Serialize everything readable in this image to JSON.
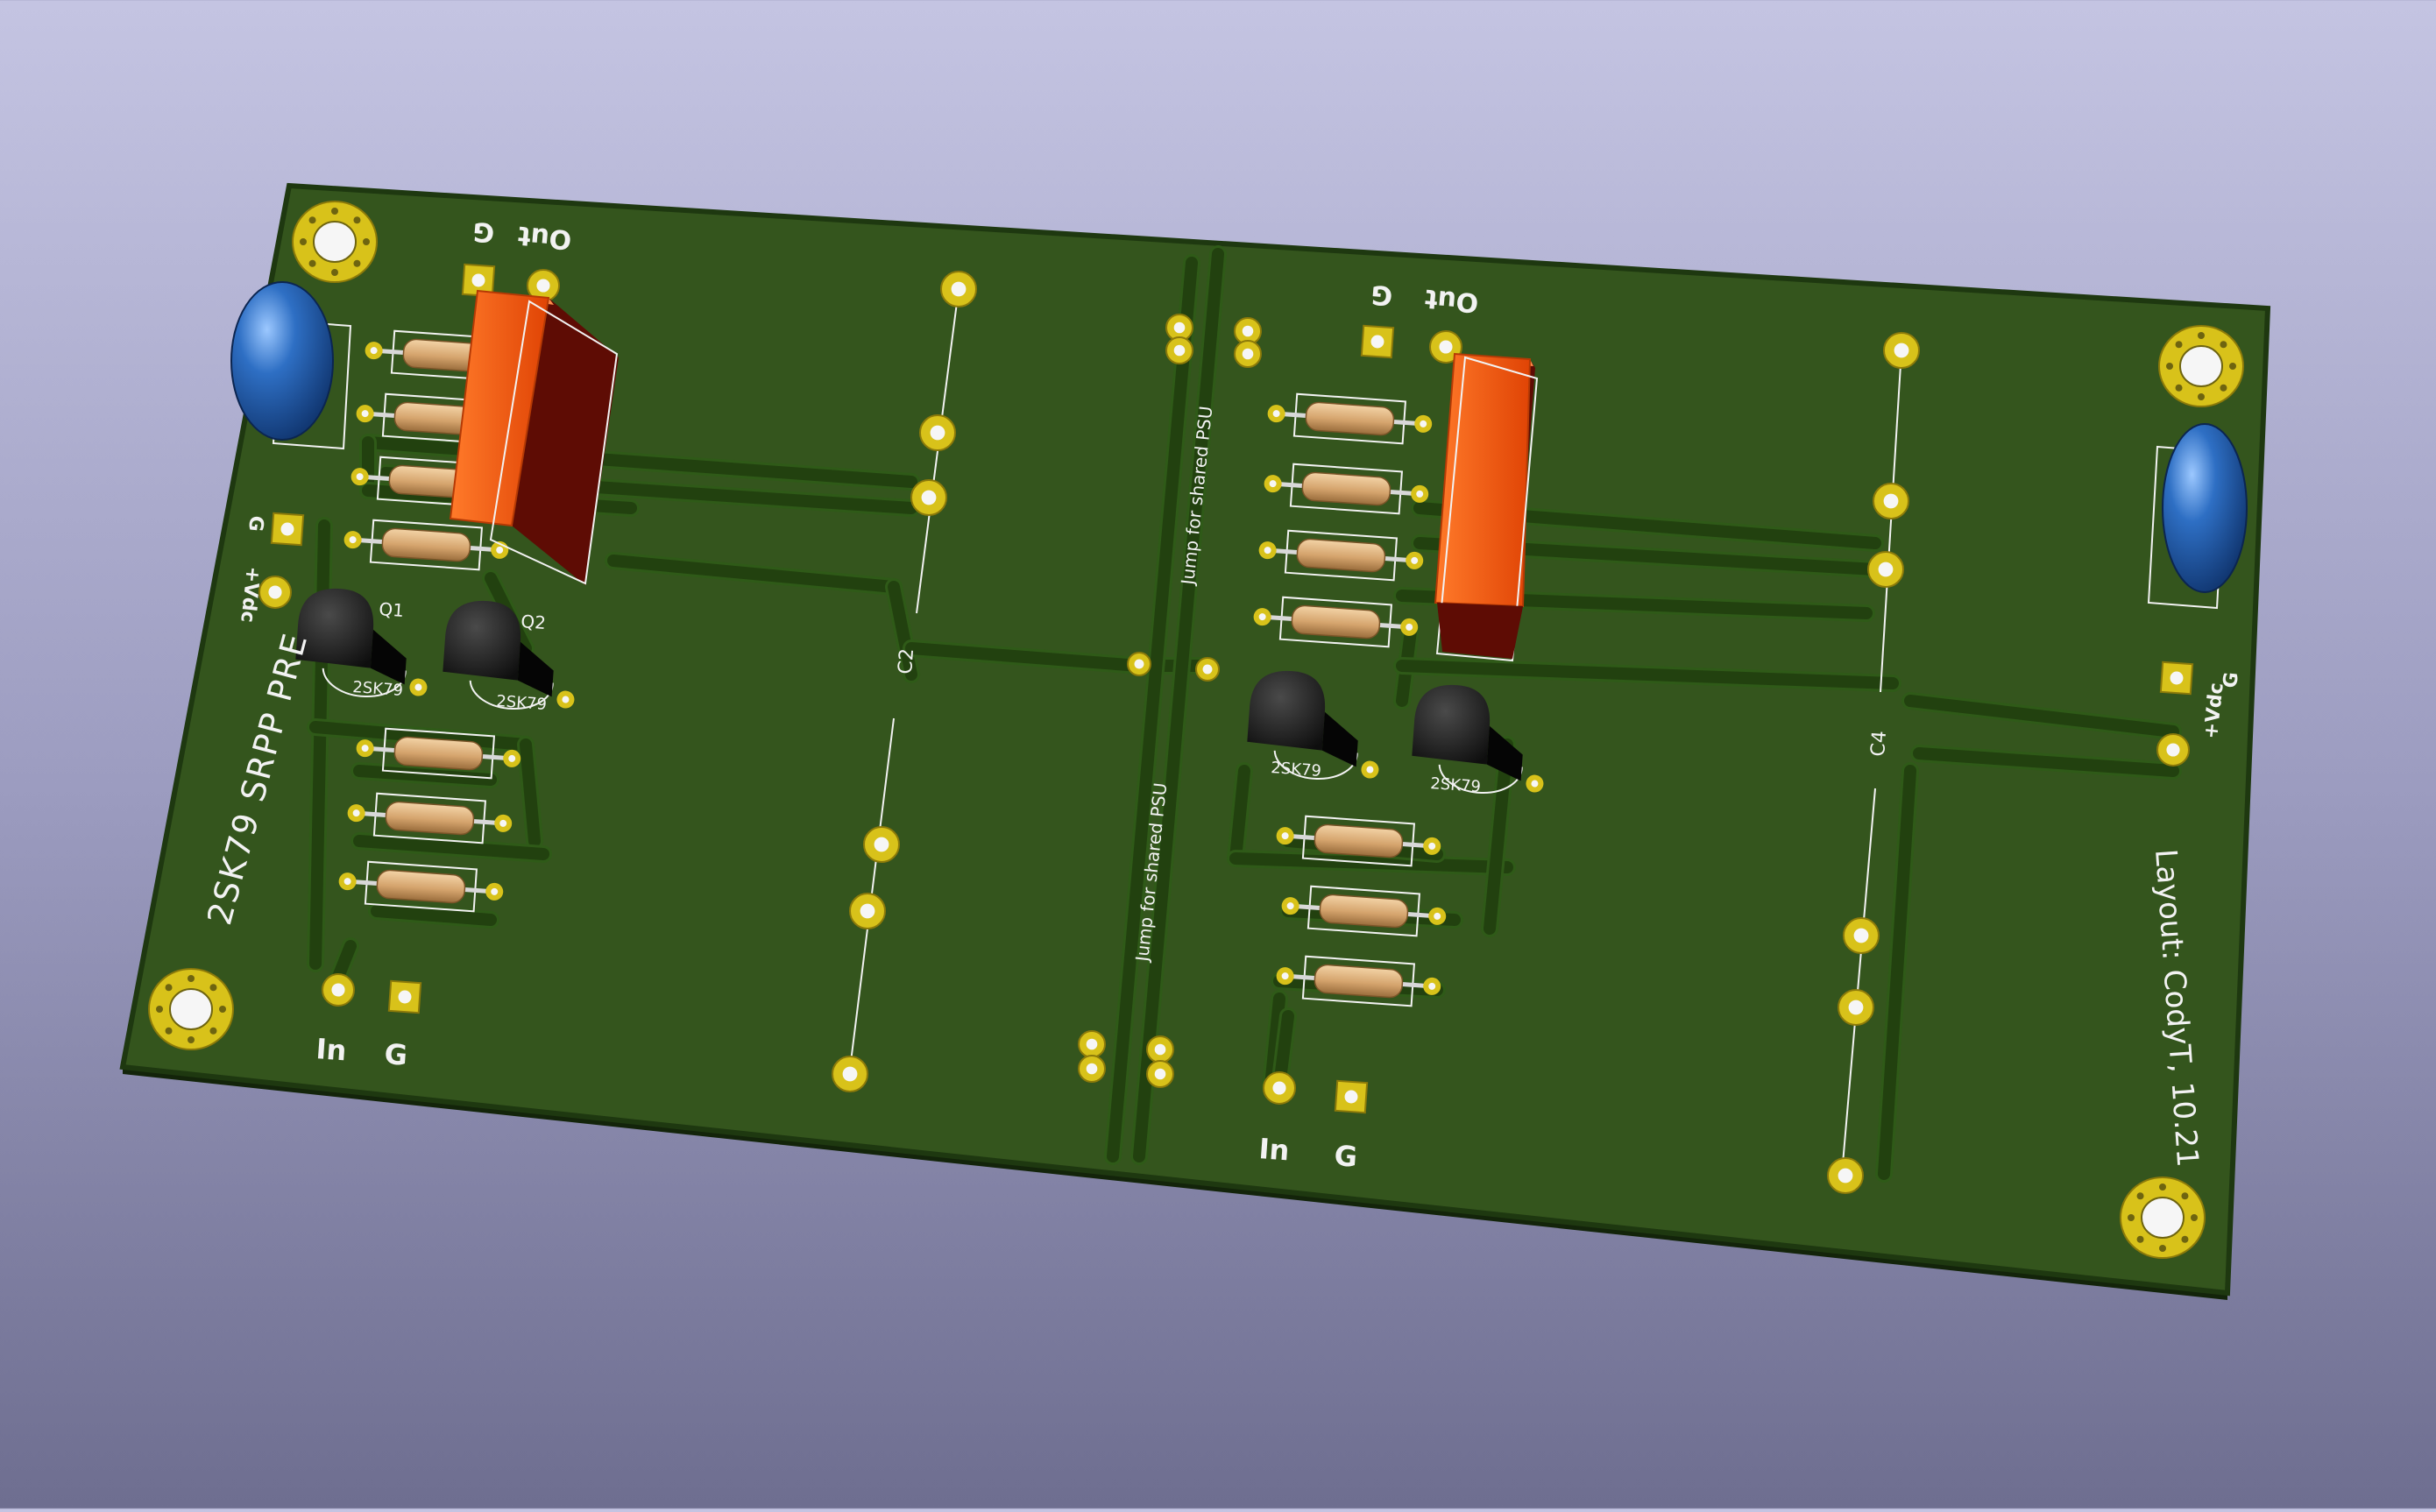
{
  "board": {
    "title": "2SK79 SRPP PRE",
    "credit": "Layout: CodyT, 10.21",
    "jumper_note": "Jump for shared PSU"
  },
  "channels": [
    {
      "out_label": "Out",
      "gnd_out_label": "G",
      "in_label": "In",
      "gnd_in_label": "G",
      "vdc_label": "+Vdc",
      "gnd_pwr_label": "G",
      "q_top_label": "Q1",
      "q_bottom_label": "Q2",
      "q_part_a": "2SK79",
      "q_part_b": "2SK79",
      "cap_label": "C2"
    },
    {
      "out_label": "Out",
      "gnd_out_label": "G",
      "in_label": "In",
      "gnd_in_label": "G",
      "vdc_label": "+Vdc",
      "gnd_pwr_label": "G",
      "q_part_a": "2SK79",
      "q_part_b": "2SK79",
      "cap_label": "C4"
    }
  ],
  "colors": {
    "background_top": "#c4c4e2",
    "background_bottom": "#6e6e90",
    "board_green": "#34551d",
    "board_edge": "#1e3810",
    "copper_trace": "#22410f",
    "pad_gold": "#d8c21a",
    "silkscreen": "#f2f2f2",
    "film_capacitor": "#f2550c",
    "electrolytic_blue": "#1f57a8",
    "transistor_black": "#1a1a1a",
    "resistor_body": "#d9b080"
  }
}
